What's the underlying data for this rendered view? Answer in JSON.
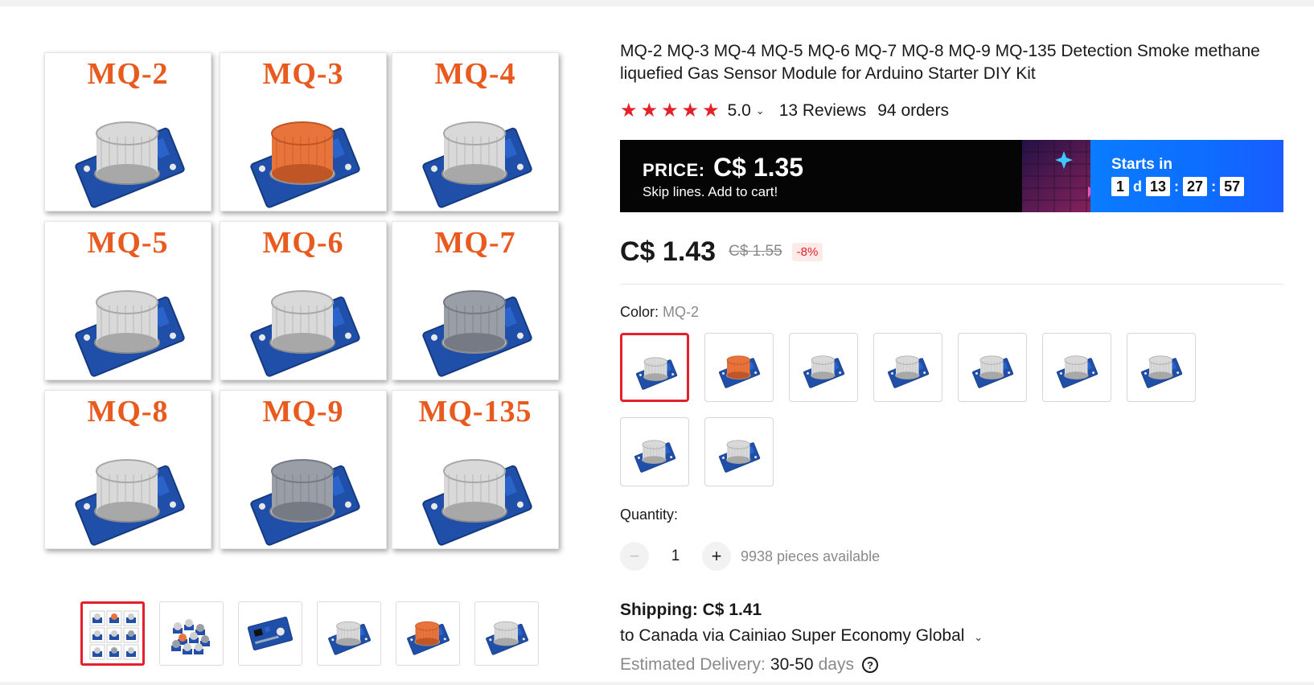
{
  "product": {
    "title": "MQ-2 MQ-3 MQ-4 MQ-5 MQ-6 MQ-7 MQ-8 MQ-9 MQ-135 Detection Smoke methane liquefied Gas Sensor Module for Arduino Starter DIY Kit"
  },
  "gallery": {
    "tiles": [
      {
        "label": "MQ-2",
        "cap": "steel"
      },
      {
        "label": "MQ-3",
        "cap": "orange"
      },
      {
        "label": "MQ-4",
        "cap": "steel"
      },
      {
        "label": "MQ-5",
        "cap": "steel"
      },
      {
        "label": "MQ-6",
        "cap": "steel"
      },
      {
        "label": "MQ-7",
        "cap": "gray"
      },
      {
        "label": "MQ-8",
        "cap": "steel"
      },
      {
        "label": "MQ-9",
        "cap": "gray"
      },
      {
        "label": "MQ-135",
        "cap": "steel"
      }
    ],
    "thumbnails": [
      "grid",
      "pile",
      "board",
      "steel",
      "orange",
      "steel"
    ],
    "selected_thumbnail": 0
  },
  "rating": {
    "stars": 5,
    "score": "5.0",
    "reviews": "13 Reviews",
    "orders": "94 orders"
  },
  "promo": {
    "price_label": "PRICE:",
    "price_value": "C$ 1.35",
    "subtitle": "Skip lines. Add to cart!",
    "starts_label": "Starts in",
    "days": "1",
    "days_unit": "d",
    "hours": "13",
    "minutes": "27",
    "seconds": "57"
  },
  "price": {
    "current": "C$ 1.43",
    "original": "C$ 1.55",
    "discount": "-8%"
  },
  "color": {
    "label": "Color:",
    "selected": "MQ-2",
    "options": [
      "steel",
      "orange",
      "steel",
      "steel",
      "steel",
      "steel",
      "steel",
      "steel",
      "steel"
    ],
    "selected_index": 0
  },
  "quantity": {
    "label": "Quantity:",
    "minus": "−",
    "value": "1",
    "plus": "+",
    "available": "9938 pieces available"
  },
  "shipping": {
    "cost": "Shipping: C$ 1.41",
    "route": "to Canada via Cainiao Super Economy Global",
    "delivery_label": "Estimated Delivery:",
    "delivery_value": "30-50",
    "delivery_unit": "days",
    "help_icon": "?"
  },
  "colors": {
    "accent": "#e4202a",
    "promo_blue": "#0a7cff",
    "label_orange": "#e85a1e",
    "board_blue": "#1f4fa8"
  }
}
